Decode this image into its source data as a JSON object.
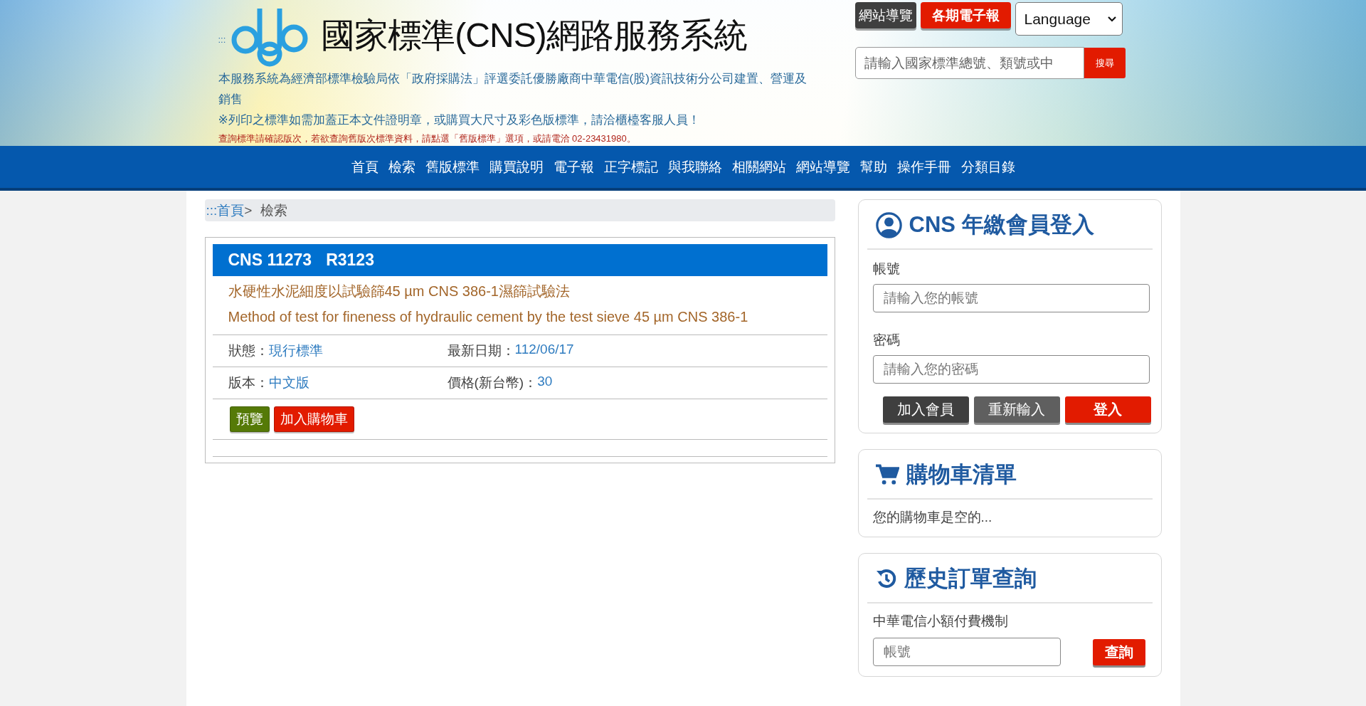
{
  "header": {
    "marker": ":::",
    "title": "國家標準(CNS)網路服務系統",
    "notices": [
      {
        "text": "本服務系統為經濟部標準檢驗局依「政府採購法」評選委託優勝廠商中華電信(股)資訊技術分公司建置、營運及銷售",
        "kind": "info"
      },
      {
        "text": "※列印之標準如需加蓋正本文件證明章，或購買大尺寸及彩色版標準，請洽櫃檯客服人員！",
        "kind": "info"
      },
      {
        "text": "查詢標準請確認版次，若欲查詢舊版次標準資料，請點選「舊版標準」選項，或請電洽 02-23431980。",
        "kind": "warning"
      }
    ],
    "top_buttons": [
      {
        "label": "網站導覽",
        "kind": "dark"
      },
      {
        "label": "各期電子報",
        "kind": "red"
      }
    ],
    "language_select": {
      "value": "Language"
    },
    "search": {
      "placeholder": "請輸入國家標準總號、類號或中",
      "button": "搜尋"
    }
  },
  "nav": {
    "items": [
      "首頁",
      "檢索",
      "舊版標準",
      "購買說明",
      "電子報",
      "正字標記",
      "與我聯絡",
      "相關網站",
      "網站導覽",
      "幫助",
      "操作手冊",
      "分類目錄"
    ]
  },
  "breadcrumb": {
    "marker": ":::",
    "home": "首頁",
    "separator": ">",
    "current": "檢索"
  },
  "standard": {
    "code": "CNS 11273",
    "class_number": "R3123",
    "title_zh": "水硬性水泥細度以試驗篩45 µm CNS 386-1濕篩試驗法",
    "title_en": "Method of test for fineness of hydraulic cement by the test sieve 45 µm CNS 386-1",
    "fields": [
      {
        "label": "狀態：",
        "value": "現行標準"
      },
      {
        "label": "最新日期：",
        "value": "112/06/17"
      },
      {
        "label": "版本：",
        "value": "中文版"
      },
      {
        "label": "價格(新台幣)：",
        "value": "30"
      }
    ],
    "buttons": [
      {
        "label": "預覽",
        "kind": "green"
      },
      {
        "label": "加入購物車",
        "kind": "red"
      }
    ]
  },
  "login": {
    "title": "CNS 年繳會員登入",
    "account_label": "帳號",
    "account_placeholder": "請輸入您的帳號",
    "password_label": "密碼",
    "password_placeholder": "請輸入您的密碼",
    "buttons": [
      {
        "label": "加入會員",
        "kind": "dark"
      },
      {
        "label": "重新輸入",
        "kind": "gray"
      },
      {
        "label": "登入",
        "kind": "red"
      }
    ]
  },
  "cart": {
    "title": "購物車清單",
    "empty_text": "您的購物車是空的..."
  },
  "history": {
    "title": "歷史訂單查詢",
    "label": "中華電信小額付費機制",
    "placeholder": "帳號",
    "button": "查詢"
  }
}
